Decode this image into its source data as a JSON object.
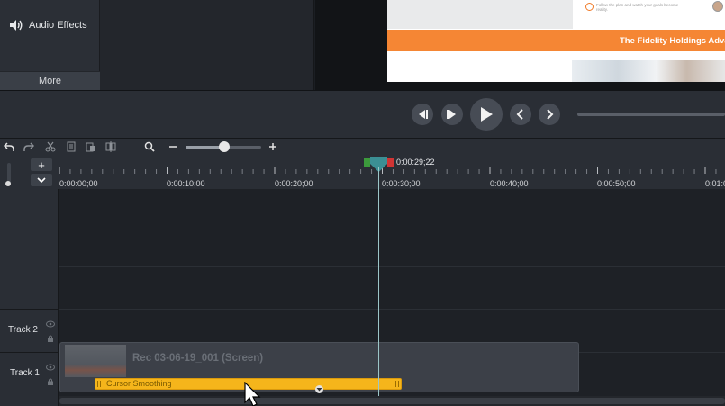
{
  "tools_panel": {
    "audio_effects_label": "Audio Effects",
    "more_label": "More"
  },
  "canvas_preview": {
    "tip_text": "Follow the plan and watch your goals become reality.",
    "banner_text": "The Fidelity Holdings Adva"
  },
  "timeline": {
    "playhead_time": "0:00:29;22",
    "ruler_ticks": [
      "0:00:00;00",
      "0:00:10;00",
      "0:00:20;00",
      "0:00:30;00",
      "0:00:40;00",
      "0:00:50;00",
      "0:01:0"
    ],
    "tracks": [
      {
        "label": "Track 2"
      },
      {
        "label": "Track 1"
      }
    ],
    "clip": {
      "title": "Rec 03-06-19_001 (Screen)",
      "effect_label": "Cursor Smoothing"
    },
    "add_track_symbol": "+"
  },
  "colors": {
    "effect_yellow": "#f5b51b",
    "banner_orange": "#f58634",
    "playhead_teal": "#3b8f94"
  }
}
